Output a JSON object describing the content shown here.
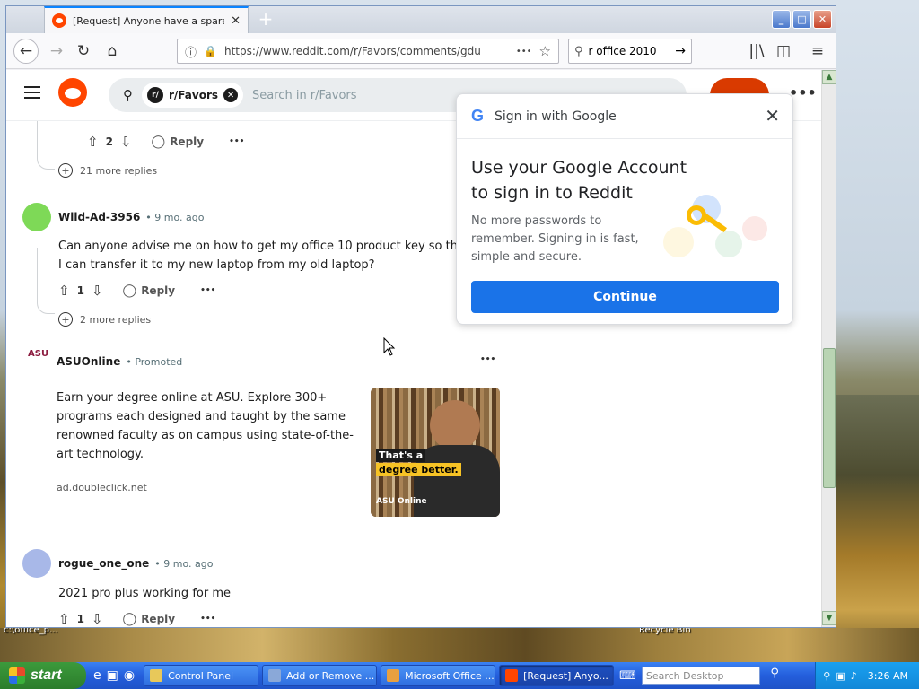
{
  "colors": {
    "accent": "#0a84ff",
    "reddit_orange": "#ff4500",
    "google_blue": "#1a73e8",
    "xp_blue": "#245edc",
    "start_green": "#3c9a3c"
  },
  "desktop": {
    "icon_label_left": "c:\\office_p...",
    "icon_label_right": "Recycle Bin"
  },
  "browser": {
    "tab_title": "[Request] Anyone have a spare, v",
    "tab_close": "✕",
    "new_tab": "+",
    "window_buttons": {
      "minimize": "_",
      "maximize": "□",
      "close": "✕"
    },
    "url": "https://www.reddit.com/r/Favors/comments/gdu",
    "url_more": "•••",
    "search_value": "r office 2010"
  },
  "reddit": {
    "subreddit_chip": "r/Favors",
    "search_placeholder": "Search in r/Favors",
    "header_more": "•••",
    "top_actions": {
      "votes": "2",
      "reply": "Reply",
      "more": "•••"
    },
    "more_replies_1": "21 more replies",
    "comment1": {
      "username": "Wild-Ad-3956",
      "meta": "• 9 mo. ago",
      "text": "Can anyone advise me on how to get my office 10 product key so that I can transfer it to my new laptop from my old laptop?",
      "votes": "1",
      "reply": "Reply",
      "more": "•••"
    },
    "more_replies_2": "2 more replies",
    "ad": {
      "advertiser": "ASUOnline",
      "promoted": "• Promoted",
      "logo_text": "ASU",
      "text": "Earn your degree online at ASU. Explore 300+ programs each designed and taught by the same renowned faculty as on campus using state-of-the-art technology.",
      "domain": "ad.doubleclick.net",
      "more": "•••",
      "image_line1": "That's a",
      "image_line2": "degree better.",
      "image_brand": "ASU Online"
    },
    "comment2": {
      "username": "rogue_one_one",
      "meta": "• 9 mo. ago",
      "text": "2021 pro plus working for me",
      "votes": "1",
      "reply": "Reply",
      "more": "•••"
    }
  },
  "google_popup": {
    "header": "Sign in with Google",
    "title": "Use your Google Account to sign in to Reddit",
    "description": "No more passwords to remember. Signing in is fast, simple and secure.",
    "button": "Continue",
    "close": "✕"
  },
  "taskbar": {
    "start": "start",
    "buttons": [
      "Control Panel",
      "Add or Remove ...",
      "Microsoft Office ...",
      "[Request] Anyo..."
    ],
    "search_placeholder": "Search Desktop",
    "clock": "3:26 AM"
  }
}
